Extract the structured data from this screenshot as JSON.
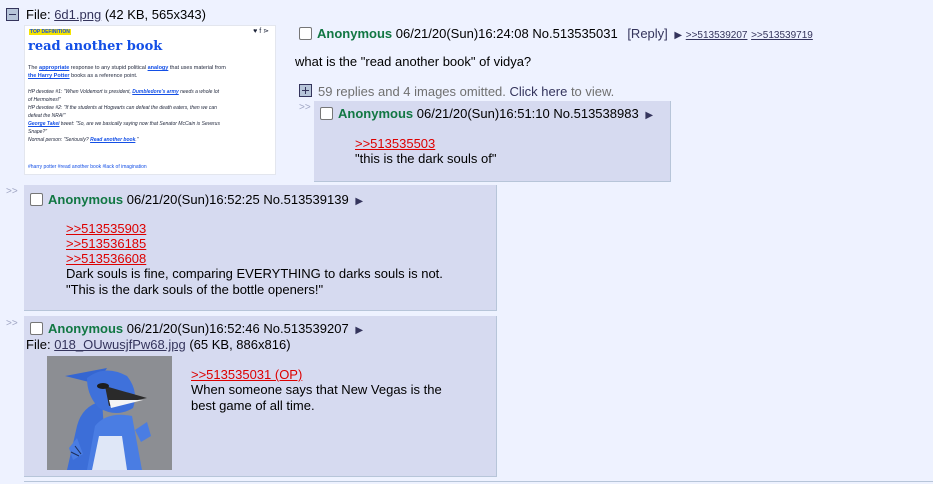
{
  "op": {
    "file_label": "File:",
    "file_name": "6d1.png",
    "file_info": "(42 KB, 565x343)",
    "name": "Anonymous",
    "datetime": "06/21/20(Sun)16:24:08",
    "post_no": "No.513535031",
    "reply_link": "[Reply]",
    "backlink_1": ">>513539207",
    "backlink_2": ">>513539719",
    "message": "what is the \"read another book\" of vidya?",
    "omitted_text": "59 replies and 4 images omitted.",
    "omitted_click": "Click here",
    "omitted_suffix": "to view."
  },
  "thumbnail_op": {
    "badge": "TOP DEFINITION",
    "icons": "♥ f ⋗",
    "title": "read another book",
    "def_1a": "The ",
    "def_1b": "appropriate",
    "def_1c": " response to any stupid political ",
    "def_1d": "analogy",
    "def_1e": " that uses material from",
    "def_2a": "the Harry Potter",
    "def_2b": " books as a reference point.",
    "ex_1a": "HP devotee #1: \"When Voldemort is president, ",
    "ex_1b": "Dumbledore's army",
    "ex_1c": " needs a whole lot",
    "ex_2": "of Hermoines!\"",
    "ex_3": "HP devotee #2: \"If the students at Hogwarts can defeat the death eaters, then we can",
    "ex_4": "defeat the NRA!\"",
    "ex_5a": "George Takei",
    "ex_5b": " tweet: \"So, are we basically saying now that Senator McCain is Severus",
    "ex_6": "Snape?\"",
    "ex_7a": "Normal person: \"Seriously? ",
    "ex_7b": "Read another book",
    "ex_7c": ".\"",
    "tags": "#harry potter #read another book #lack of imagination"
  },
  "posts": [
    {
      "sideline": ">>",
      "name": "Anonymous",
      "datetime": "06/21/20(Sun)16:51:10",
      "post_no": "No.513538983",
      "quote_1": ">>513535503",
      "message_1": "\"this is the dark souls of\""
    },
    {
      "sideline": ">>",
      "name": "Anonymous",
      "datetime": "06/21/20(Sun)16:52:25",
      "post_no": "No.513539139",
      "quote_1": ">>513535903",
      "quote_2": ">>513536185",
      "quote_3": ">>513536608",
      "message_1": "Dark souls is fine, comparing EVERYTHING to darks souls is not.",
      "message_2": "\"This is the dark souls of the bottle openers!\""
    },
    {
      "sideline": ">>",
      "name": "Anonymous",
      "datetime": "06/21/20(Sun)16:52:46",
      "post_no": "No.513539207",
      "file_label": "File:",
      "file_name": "018_OUwusjfPw68.jpg",
      "file_info": "(65 KB, 886x816)",
      "quote_1": ">>513535031 (OP)",
      "message_1": "When someone says that New Vegas is the",
      "message_2": "best game of all time."
    }
  ],
  "colors": {
    "background": "#eef2ff",
    "reply_bg": "#d6daf0",
    "name_green": "#117743",
    "quote_red": "#dd0000",
    "link_blue": "#34345c"
  }
}
